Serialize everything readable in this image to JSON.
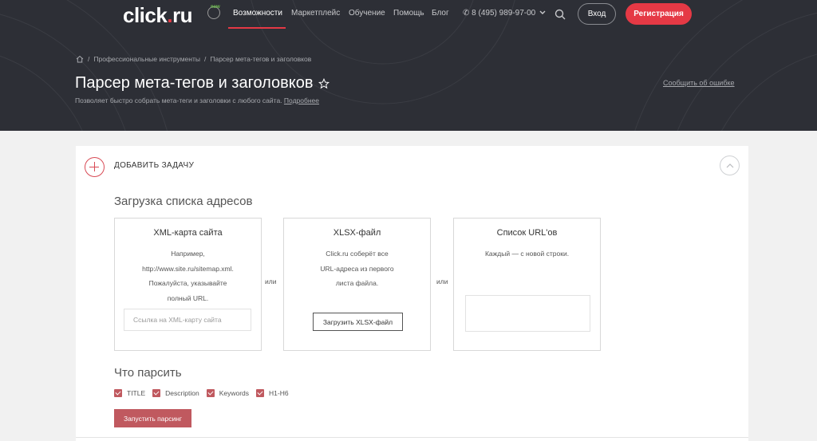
{
  "header": {
    "logo_text": "click",
    "logo_dot": ".",
    "logo_tld": "ru",
    "new_badge": "new",
    "nav": [
      {
        "label": "Возможности",
        "active": true
      },
      {
        "label": "Маркетплейс",
        "active": false
      },
      {
        "label": "Обучение",
        "active": false
      },
      {
        "label": "Помощь",
        "active": false
      },
      {
        "label": "Блог",
        "active": false
      }
    ],
    "phone": "8 (495) 989-97-00",
    "login_label": "Вход",
    "register_label": "Регистрация",
    "accent_color": "#e53945"
  },
  "breadcrumb": {
    "separator": "/",
    "items": [
      "Профессиональные инструменты",
      "Парсер мета-тегов и заголовков"
    ]
  },
  "page": {
    "title": "Парсер мета-тегов и заголовков",
    "subtitle": "Позволяет быстро собрать мета-теги и заголовки с любого сайта.",
    "more_link": "Подробнее",
    "report_link": "Сообщить об ошибке"
  },
  "task": {
    "add_label": "ДОБАВИТЬ ЗАДАЧУ",
    "upload_section_title": "Загрузка списка адресов",
    "or_label": "или",
    "sources": {
      "xml": {
        "title": "XML-карта сайта",
        "lines": [
          "Например,",
          "http://www.site.ru/sitemap.xml.",
          "Пожалуйста, указывайте",
          "полный URL."
        ],
        "input_placeholder": "Ссылка на XML-карту сайта"
      },
      "xlsx": {
        "title": "XLSX-файл",
        "lines": [
          "Click.ru соберёт все",
          "URL-адреса из первого",
          "листа файла."
        ],
        "button_label": "Загрузить XLSX-файл"
      },
      "list": {
        "title": "Список URL'ов",
        "lines": [
          "Каждый — с новой строки."
        ]
      }
    },
    "parse_section_title": "Что парсить",
    "checkboxes": [
      {
        "label": "TITLE",
        "checked": true
      },
      {
        "label": "Description",
        "checked": true
      },
      {
        "label": "Keywords",
        "checked": true
      },
      {
        "label": "H1-H6",
        "checked": true
      }
    ],
    "run_label": "Запустить парсинг",
    "run_color": "#c0595f"
  }
}
